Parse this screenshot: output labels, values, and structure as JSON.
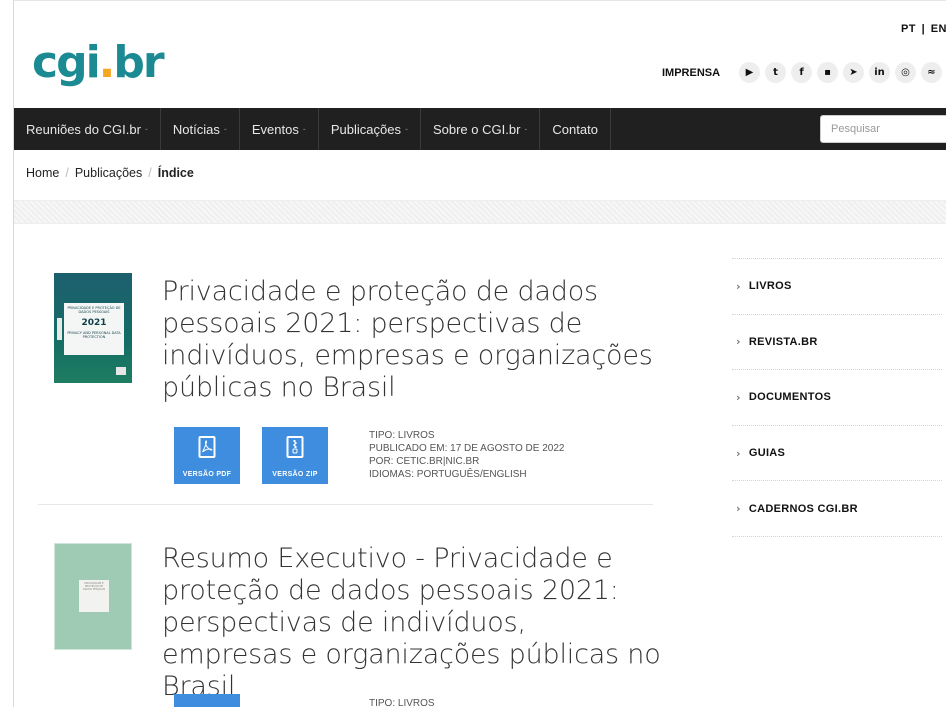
{
  "header": {
    "logo_text": "cgi",
    "logo_dot": ".",
    "logo_suffix": "br",
    "lang_pt": "PT",
    "lang_sep": "|",
    "lang_en": "EN",
    "imprensa": "IMPRENSA",
    "socials": [
      {
        "icon": "youtube-icon",
        "glyph": "▶"
      },
      {
        "icon": "twitter-icon",
        "glyph": "t"
      },
      {
        "icon": "facebook-icon",
        "glyph": "f"
      },
      {
        "icon": "flickr-icon",
        "glyph": "▪"
      },
      {
        "icon": "telegram-icon",
        "glyph": "➤"
      },
      {
        "icon": "linkedin-icon",
        "glyph": "in"
      },
      {
        "icon": "instagram-icon",
        "glyph": "◎"
      },
      {
        "icon": "rss-icon",
        "glyph": "≈"
      }
    ]
  },
  "nav": {
    "items": [
      {
        "label": "Reuniões do CGI.br",
        "caret": "-"
      },
      {
        "label": "Notícias",
        "caret": "-"
      },
      {
        "label": "Eventos",
        "caret": "-"
      },
      {
        "label": "Publicações",
        "caret": "-"
      },
      {
        "label": "Sobre o CGI.br",
        "caret": "-"
      },
      {
        "label": "Contato",
        "caret": ""
      }
    ],
    "search_placeholder": "Pesquisar"
  },
  "breadcrumb": {
    "home": "Home",
    "sep1": "/",
    "publicacoes": "Publicações",
    "sep2": "/",
    "current": "Índice"
  },
  "publications": [
    {
      "title": "Privacidade e proteção de dados pessoais 2021: perspectivas de indivíduos, empresas e organizações públicas no Brasil",
      "cover_lines": "PRIVACIDADE E PROTEÇÃO DE DADOS PESSOAIS",
      "cover_year": "2021",
      "cover_lines_en": "PRIVACY AND PERSONAL DATA PROTECTION",
      "btn_pdf": "VERSÃO PDF",
      "btn_zip": "VERSÃO ZIP",
      "tipo": "TIPO: LIVROS",
      "publicado": "PUBLICADO EM: 17 DE AGOSTO DE 2022",
      "por": "POR: CETIC.BR|NIC.BR",
      "idiomas": "IDIOMAS: PORTUGUÊS/ENGLISH"
    },
    {
      "title": "Resumo Executivo - Privacidade e proteção de dados pessoais 2021: perspectivas de indivíduos, empresas e organizações públicas no Brasil",
      "cover_lines": "PRIVACIDADE E PROTEÇÃO DE DADOS PESSOAIS",
      "tipo": "TIPO: LIVROS"
    }
  ],
  "sidebar": {
    "items": [
      {
        "label": "LIVROS"
      },
      {
        "label": "REVISTA.BR"
      },
      {
        "label": "DOCUMENTOS"
      },
      {
        "label": "GUIAS"
      },
      {
        "label": "CADERNOS CGI.BR"
      }
    ],
    "chevron": "›"
  },
  "colors": {
    "logo": "#1c8a93",
    "nav_bg": "#202020",
    "button_blue": "#3f8ddf"
  }
}
